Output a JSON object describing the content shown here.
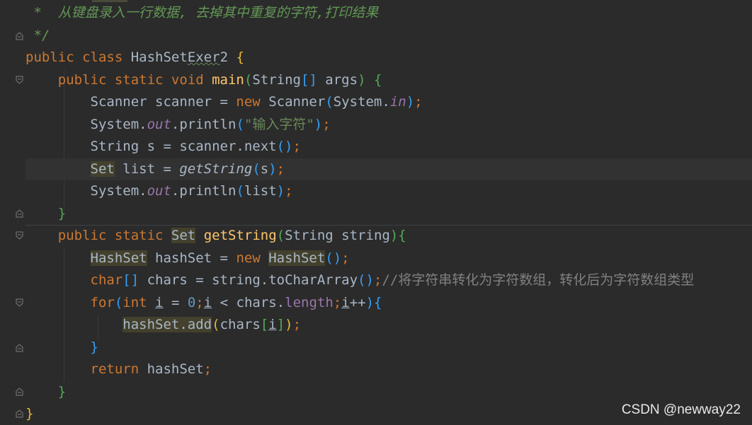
{
  "editor": {
    "lines": [
      {
        "html": "<span class=\"cmt\"> *  从键盘录入一行数据, 去掉其中重复的字符,打印结果</span>"
      },
      {
        "html": "<span class=\"cmt\"> */</span>"
      },
      {
        "html": "<span class=\"kw\">public class </span>HashSet<span class=\"typo\">Exer</span>2 <span class=\"p1\">{</span>"
      },
      {
        "html": "    <span class=\"kw\">public static void </span><span class=\"fn\">main</span><span class=\"p2\">(</span>String<span class=\"p3\">[]</span> args<span class=\"p2\">)</span> <span class=\"p2\">{</span>"
      },
      {
        "html": "        Scanner scanner = <span class=\"kw\">new </span>Scanner<span class=\"p3\">(</span>System.<span class=\"field\">in</span><span class=\"p3\">)</span><span class=\"kw\">;</span>"
      },
      {
        "html": "        System.<span class=\"field\">out</span>.println<span class=\"p3\">(</span><span class=\"str\">\"输入字符\"</span><span class=\"p3\">)</span><span class=\"kw\">;</span>"
      },
      {
        "html": "        String s = scanner.next<span class=\"p3\">()</span><span class=\"kw\">;</span>"
      },
      {
        "html": "        <span class=\"hl\">Set</span> list = <span class=\"static-call\">getString</span><span class=\"p3\">(</span>s<span class=\"p3\">)</span><span class=\"kw\">;</span>"
      },
      {
        "html": "        System.<span class=\"field\">out</span>.println<span class=\"p3\">(</span>list<span class=\"p3\">)</span><span class=\"kw\">;</span>"
      },
      {
        "html": "    <span class=\"p2\">}</span>"
      },
      {
        "html": "    <span class=\"kw\">public static </span><span class=\"hl\">Set</span> <span class=\"fn\">getString</span><span class=\"p2\">(</span>String string<span class=\"p2\">)</span><span class=\"p2\">{</span>"
      },
      {
        "html": "        <span class=\"hl\">HashSet</span> hashSet = <span class=\"kw\">new </span><span class=\"hl\">HashSet</span><span class=\"p3\">()</span><span class=\"kw\">;</span>"
      },
      {
        "html": "        <span class=\"kw\">char</span><span class=\"p3\">[]</span> chars = string.toCharArray<span class=\"p3\">()</span><span class=\"kw\">;</span><span class=\"line-cmt\">//将字符串转化为字符数组，转化后为字符数组类型</span>"
      },
      {
        "html": "        <span class=\"kw\">for</span><span class=\"p3\">(</span><span class=\"kw\">int </span><span class=\"ul\">i</span> = <span class=\"num\">0</span><span class=\"kw\">;</span><span class=\"ul\">i</span> &lt; chars.<span class=\"member\">length</span><span class=\"kw\">;</span><span class=\"ul\">i</span>++<span class=\"p3\">)</span><span class=\"p3\">{</span>"
      },
      {
        "html": "            <span class=\"hl\">hashSet.add</span><span class=\"p1\">(</span>chars<span class=\"p2\">[</span><span class=\"ul\">i</span><span class=\"p2\">]</span><span class=\"p1\">)</span><span class=\"kw\">;</span>"
      },
      {
        "html": "        <span class=\"p3\">}</span>"
      },
      {
        "html": "        <span class=\"kw\">return </span>hashSet<span class=\"kw\">;</span>"
      },
      {
        "html": "    <span class=\"p2\">}</span>"
      },
      {
        "html": "<span class=\"p1\">}</span>"
      }
    ]
  },
  "watermark": "CSDN @newway22"
}
